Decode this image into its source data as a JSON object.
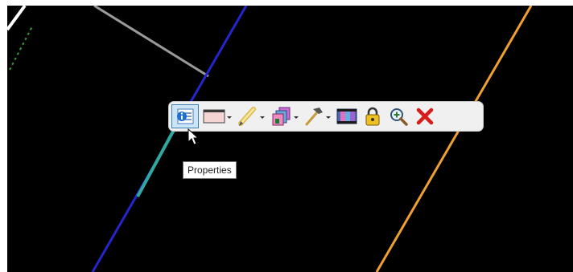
{
  "toolbar": {
    "tools": [
      {
        "id": "properties",
        "icon": "properties-icon",
        "active": true,
        "dropdown": false
      },
      {
        "id": "display",
        "icon": "window-icon",
        "active": false,
        "dropdown": true
      },
      {
        "id": "edit",
        "icon": "pencil-icon",
        "active": false,
        "dropdown": true
      },
      {
        "id": "transform",
        "icon": "layers-icon",
        "active": false,
        "dropdown": true
      },
      {
        "id": "build",
        "icon": "hammer-icon",
        "active": false,
        "dropdown": true
      },
      {
        "id": "level",
        "icon": "film-icon",
        "active": false,
        "dropdown": false
      },
      {
        "id": "lock",
        "icon": "lock-icon",
        "active": false,
        "dropdown": false
      },
      {
        "id": "zoom",
        "icon": "zoom-icon",
        "active": false,
        "dropdown": false
      },
      {
        "id": "delete",
        "icon": "delete-icon",
        "active": false,
        "dropdown": false
      }
    ]
  },
  "tooltip": {
    "text": "Properties"
  },
  "colors": {
    "canvas": "#000000",
    "element_blue": "#2222cc",
    "element_orange": "#f0a030",
    "element_gray": "#9a9a9a",
    "element_green": "#3a9a3a",
    "delete_red": "#d81b1b"
  }
}
